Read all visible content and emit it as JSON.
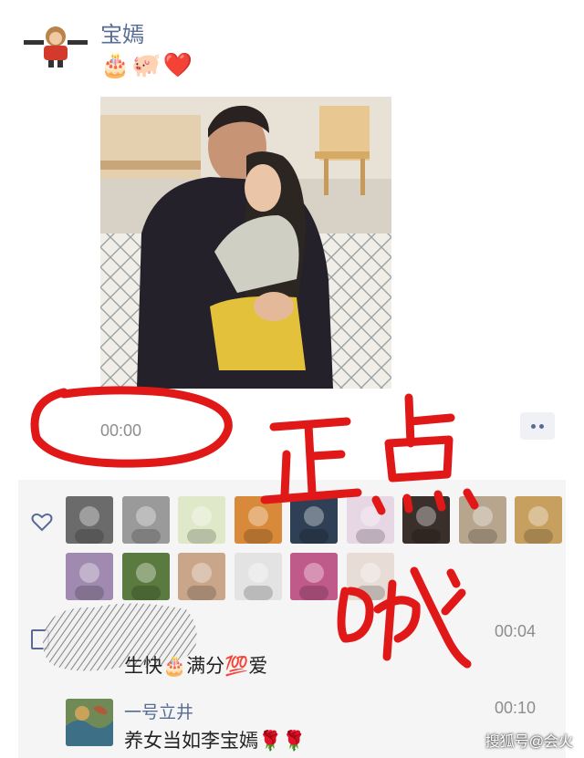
{
  "post": {
    "username": "宝嫣",
    "emoji_text": "🎂🐖❤️",
    "time": "00:00"
  },
  "likes": {
    "count_rows": 2,
    "thumb_colors": [
      "#6b6b6b",
      "#9a9a9a",
      "#dfe8c8",
      "#d9893a",
      "#2f3f55",
      "#e7d6e3",
      "#3a2f2a",
      "#b7a58e",
      "#c7a060",
      "#a08ab0",
      "#5b7a3f",
      "#c9a68a",
      "#e3e3e3",
      "#c05a8a",
      "#e8dcd6"
    ]
  },
  "comments": [
    {
      "name": "",
      "time": "00:04",
      "text": "生快🎂满分💯爱"
    },
    {
      "name": "一号立井",
      "time": "00:10",
      "text": "养女当如李宝嫣🌹🌹"
    }
  ],
  "annotation": {
    "handwriting": "正点哦"
  },
  "watermark": "搜狐号@会火",
  "colors": {
    "link": "#576b95",
    "annotation_red": "#e01818"
  }
}
